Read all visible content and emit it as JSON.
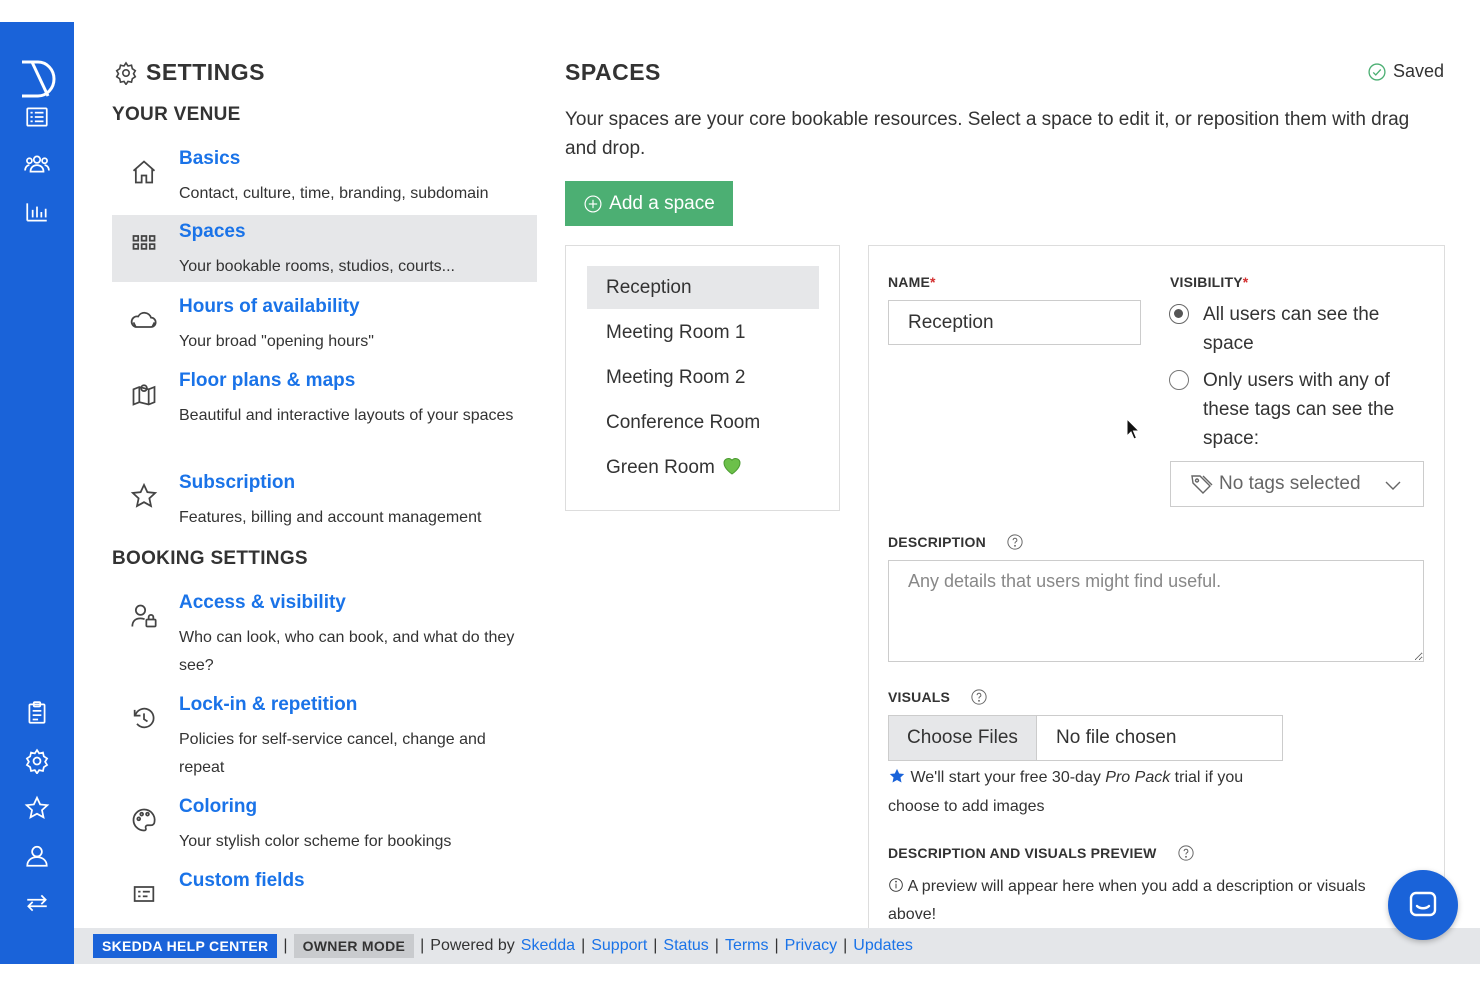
{
  "settings": {
    "title": "SETTINGS",
    "venue_heading": "YOUR VENUE",
    "booking_heading": "BOOKING SETTINGS",
    "venue_items": [
      {
        "label": "Basics",
        "desc": "Contact, culture, time, branding, subdomain"
      },
      {
        "label": "Spaces",
        "desc": "Your bookable rooms, studios, courts..."
      },
      {
        "label": "Hours of availability",
        "desc": "Your broad \"opening hours\""
      },
      {
        "label": "Floor plans & maps",
        "desc": "Beautiful and interactive layouts of your spaces"
      },
      {
        "label": "Subscription",
        "desc": "Features, billing and account management"
      }
    ],
    "booking_items": [
      {
        "label": "Access & visibility",
        "desc": "Who can look, who can book, and what do they see?"
      },
      {
        "label": "Lock-in & repetition",
        "desc": "Policies for self-service cancel, change and repeat"
      },
      {
        "label": "Coloring",
        "desc": "Your stylish color scheme for bookings"
      },
      {
        "label": "Custom fields",
        "desc": ""
      }
    ]
  },
  "main": {
    "title": "SPACES",
    "saved": "Saved",
    "intro": "Your spaces are your core bookable resources. Select a space to edit it, or reposition them with drag and drop.",
    "add_button": "Add a space",
    "spaces": [
      "Reception",
      "Meeting Room 1",
      "Meeting Room 2",
      "Conference Room",
      "Green Room"
    ],
    "selected_space": "Reception"
  },
  "form": {
    "name_label": "NAME",
    "name_value": "Reception",
    "required_mark": "*",
    "visibility_label": "VISIBILITY",
    "visibility_options": [
      "All users can see the space",
      "Only users with any of these tags can see the space:"
    ],
    "visibility_selected": 0,
    "tags_placeholder": "No tags selected",
    "description_label": "DESCRIPTION",
    "description_placeholder": "Any details that users might find useful.",
    "visuals_label": "VISUALS",
    "choose_files": "Choose Files",
    "no_file": "No file chosen",
    "pro_note_pre": "We'll start your free 30-day ",
    "pro_note_em": "Pro Pack",
    "pro_note_post": " trial if you choose to add images",
    "preview_label": "DESCRIPTION AND VISUALS PREVIEW",
    "preview_note": "A preview will appear here when you add a description or visuals above!"
  },
  "footer": {
    "help_center": "SKEDDA HELP CENTER",
    "owner_mode": "OWNER MODE",
    "powered_by": "Powered by",
    "brand_link": "Skedda",
    "links": [
      "Support",
      "Status",
      "Terms",
      "Privacy",
      "Updates"
    ]
  },
  "colors": {
    "rail": "#1a63d9",
    "link": "#1a73e8",
    "add_button": "#4caf73",
    "required": "#d32f2f"
  }
}
